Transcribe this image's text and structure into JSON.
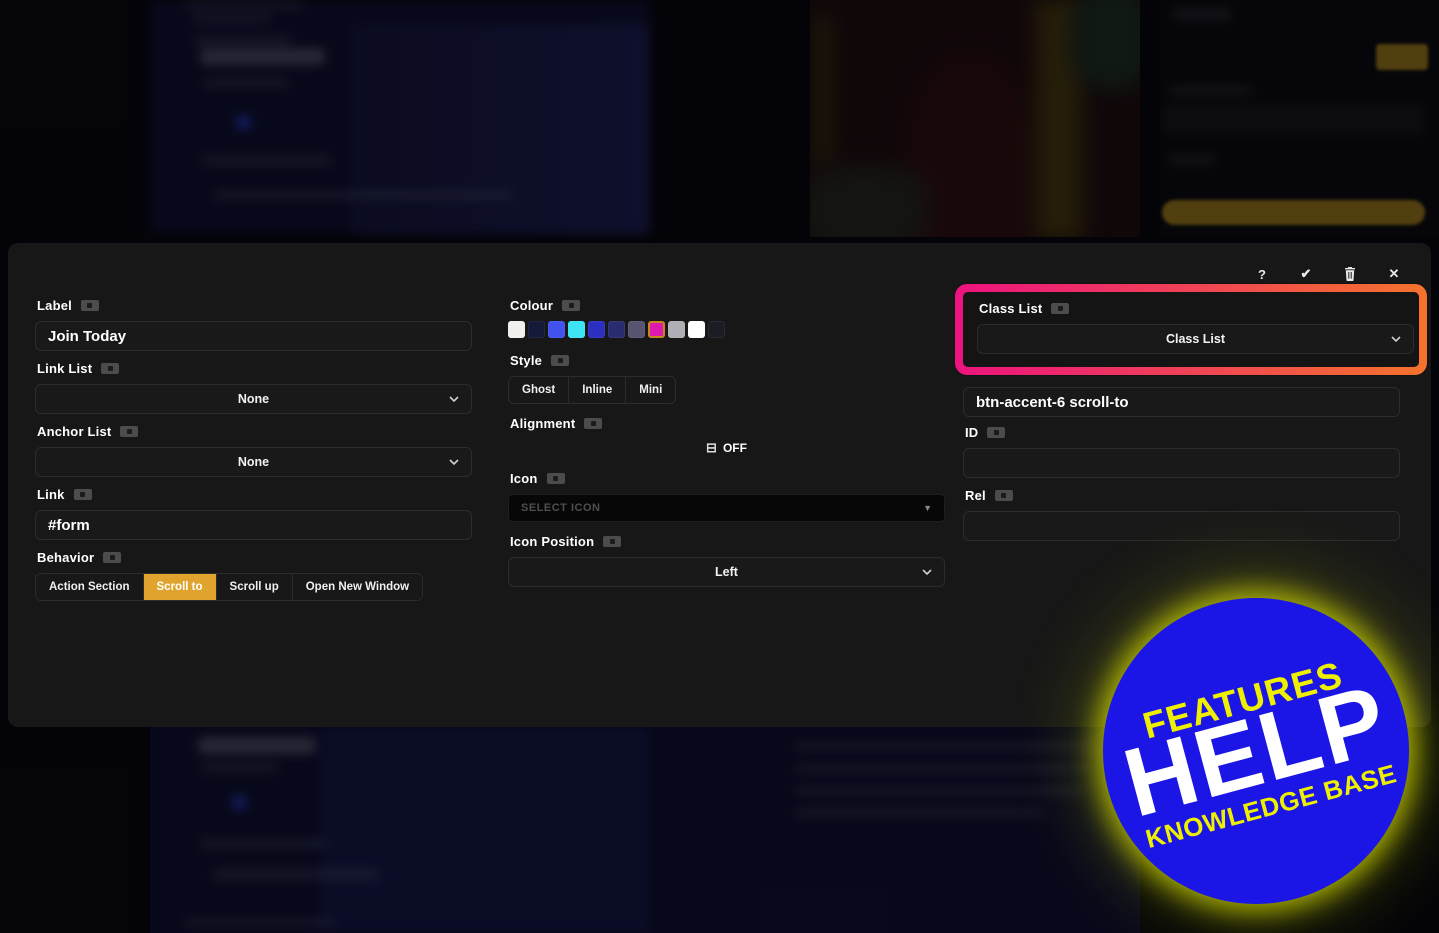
{
  "panel": {
    "toolbar": {
      "icons": [
        "help",
        "confirm",
        "delete",
        "close"
      ],
      "help_glyph": "?",
      "confirm_glyph": "✔",
      "close_glyph": "✕"
    },
    "left": {
      "label_field": {
        "label": "Label",
        "value": "Join Today"
      },
      "link_list": {
        "label": "Link List",
        "value": "None"
      },
      "anchor_list": {
        "label": "Anchor List",
        "value": "None"
      },
      "link": {
        "label": "Link",
        "value": "#form"
      },
      "behavior": {
        "label": "Behavior",
        "options": [
          "Action Section",
          "Scroll to",
          "Scroll up",
          "Open New Window"
        ],
        "selected": "Scroll to"
      }
    },
    "middle": {
      "colour": {
        "label": "Colour",
        "swatches": [
          "#f2f0ee",
          "#141a38",
          "#4152ee",
          "#3ce4f6",
          "#2b2fc2",
          "#292d70",
          "#575472",
          "#dd1ab0",
          "#aeaeb4",
          "#ffffff",
          "#1b1d24"
        ],
        "selected_index": 7,
        "selected_ring_color": "#c8871e"
      },
      "style": {
        "label": "Style",
        "options": [
          "Ghost",
          "Inline",
          "Mini"
        ]
      },
      "alignment": {
        "label": "Alignment",
        "off_glyph": "⊟",
        "state": "OFF"
      },
      "icon": {
        "label": "Icon",
        "placeholder": "SELECT ICON",
        "arrow_glyph": "▼"
      },
      "icon_position": {
        "label": "Icon Position",
        "value": "Left"
      }
    },
    "right": {
      "class_list": {
        "label": "Class List",
        "dropdown_value": "Class List"
      },
      "class_input_value": "btn-accent-6 scroll-to",
      "id_field": {
        "label": "ID",
        "value": ""
      },
      "rel_field": {
        "label": "Rel",
        "value": ""
      },
      "highlight_gradient": [
        "#ec137f",
        "#f4732c"
      ]
    },
    "accent_yellow": "#dfa32e"
  },
  "badge": {
    "line1": "FEATURES",
    "line2": "HELP",
    "line3": "KNOWLEDGE BASE",
    "circle_color": "#1b15e6",
    "glow_color": "#d0da00"
  }
}
